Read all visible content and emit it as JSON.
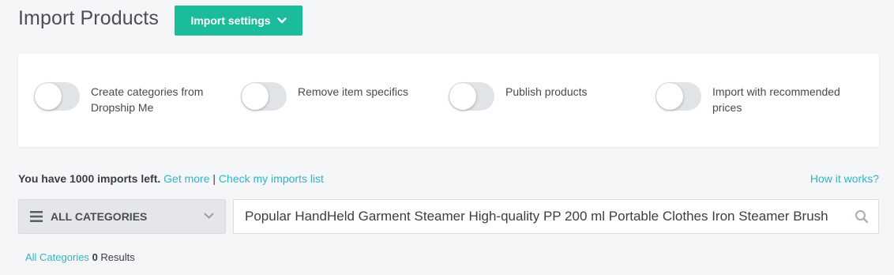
{
  "header": {
    "title": "Import Products",
    "settings_button": "Import settings",
    "accent_color": "#1bbc9b"
  },
  "options": [
    {
      "label": "Create categories from Dropship Me",
      "enabled": false
    },
    {
      "label": "Remove item specifics",
      "enabled": false
    },
    {
      "label": "Publish products",
      "enabled": false
    },
    {
      "label": "Import with recommended prices",
      "enabled": false
    }
  ],
  "imports": {
    "status_text": "You have 1000 imports left.",
    "get_more": "Get more",
    "separator": "|",
    "check_list": "Check my imports list",
    "how_it_works": "How it works?",
    "link_color": "#30b5c8"
  },
  "search": {
    "category_label": "ALL CATEGORIES",
    "query": "Popular HandHeld Garment Steamer High-quality PP 200 ml Portable Clothes Iron Steamer Brush",
    "icons": {
      "menu": "menu-icon",
      "dropdown": "chevron-down-icon",
      "search": "search-icon"
    }
  },
  "results": {
    "category": "All Categories",
    "count": "0",
    "suffix": "Results"
  }
}
